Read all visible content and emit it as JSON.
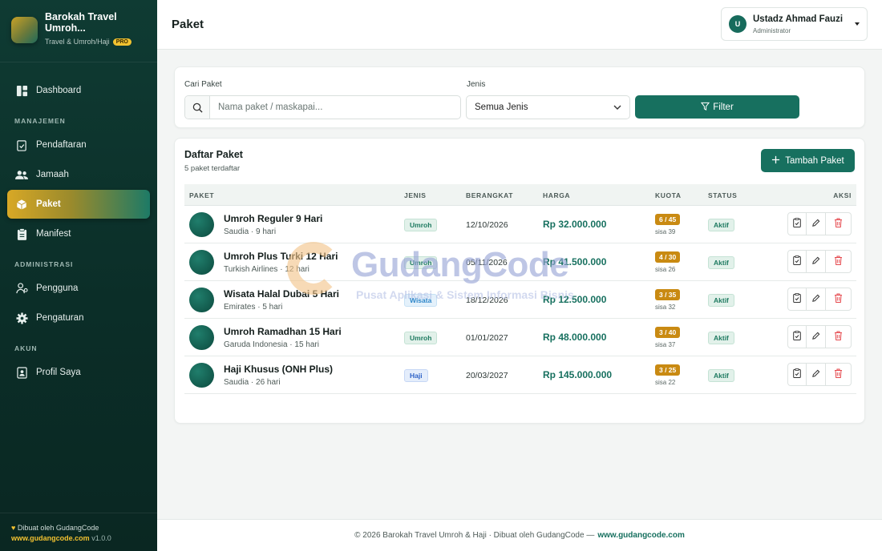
{
  "brand": {
    "name": "Barokah Travel Umroh...",
    "subtitle": "Travel & Umroh/Haji",
    "badge": "PRO"
  },
  "sidebar": {
    "items": [
      {
        "label": "Dashboard",
        "icon": "dashboard-icon"
      },
      {
        "section": "MANAJEMEN"
      },
      {
        "label": "Pendaftaran",
        "icon": "clipboard-check-icon"
      },
      {
        "label": "Jamaah",
        "icon": "users-icon"
      },
      {
        "label": "Paket",
        "icon": "box-icon",
        "active": true
      },
      {
        "label": "Manifest",
        "icon": "clipboard-list-icon"
      },
      {
        "section": "ADMINISTRASI"
      },
      {
        "label": "Pengguna",
        "icon": "user-gear-icon"
      },
      {
        "label": "Pengaturan",
        "icon": "gear-icon"
      },
      {
        "section": "AKUN"
      },
      {
        "label": "Profil Saya",
        "icon": "id-card-icon"
      }
    ],
    "footer": {
      "credit": "Dibuat oleh GudangCode",
      "link": "www.gudangcode.com",
      "version": "v1.0.0"
    }
  },
  "header": {
    "title": "Paket",
    "user": {
      "initial": "U",
      "name": "Ustadz Ahmad Fauzi",
      "role": "Administrator"
    }
  },
  "filter": {
    "search_label": "Cari Paket",
    "search_placeholder": "Nama paket / maskapai...",
    "type_label": "Jenis",
    "type_selected": "Semua Jenis",
    "button_label": "Filter"
  },
  "list": {
    "title": "Daftar Paket",
    "subtitle": "5 paket terdaftar",
    "add_button": "Tambah Paket",
    "columns": [
      "PAKET",
      "JENIS",
      "BERANGKAT",
      "HARGA",
      "KUOTA",
      "STATUS",
      "AKSI"
    ],
    "rows": [
      {
        "name": "Umroh Reguler 9 Hari",
        "meta": "Saudia · 9 hari",
        "type": "Umroh",
        "date": "12/10/2026",
        "price": "Rp 32.000.000",
        "quota": "6 / 45",
        "remaining": "sisa 39",
        "status": "Aktif"
      },
      {
        "name": "Umroh Plus Turki 12 Hari",
        "meta": "Turkish Airlines · 12 hari",
        "type": "Umroh",
        "date": "05/11/2026",
        "price": "Rp 41.500.000",
        "quota": "4 / 30",
        "remaining": "sisa 26",
        "status": "Aktif"
      },
      {
        "name": "Wisata Halal Dubai 5 Hari",
        "meta": "Emirates · 5 hari",
        "type": "Wisata",
        "date": "18/12/2026",
        "price": "Rp 12.500.000",
        "quota": "3 / 35",
        "remaining": "sisa 32",
        "status": "Aktif"
      },
      {
        "name": "Umroh Ramadhan 15 Hari",
        "meta": "Garuda Indonesia · 15 hari",
        "type": "Umroh",
        "date": "01/01/2027",
        "price": "Rp 48.000.000",
        "quota": "3 / 40",
        "remaining": "sisa 37",
        "status": "Aktif"
      },
      {
        "name": "Haji Khusus (ONH Plus)",
        "meta": "Saudia · 26 hari",
        "type": "Haji",
        "date": "20/03/2027",
        "price": "Rp 145.000.000",
        "quota": "3 / 25",
        "remaining": "sisa 22",
        "status": "Aktif"
      }
    ]
  },
  "watermark": {
    "title": "GudangCode",
    "subtitle": "Pusat Aplikasi & Sistem Informasi Bisnis"
  },
  "footer": {
    "text": "© 2026 Barokah Travel Umroh & Haji · Dibuat oleh GudangCode —",
    "link": "www.gudangcode.com"
  },
  "colors": {
    "primary": "#17705f",
    "sidebar": "#0f3b33",
    "accent": "#d8a826",
    "quota": "#c98a12",
    "danger": "#e5484d"
  }
}
